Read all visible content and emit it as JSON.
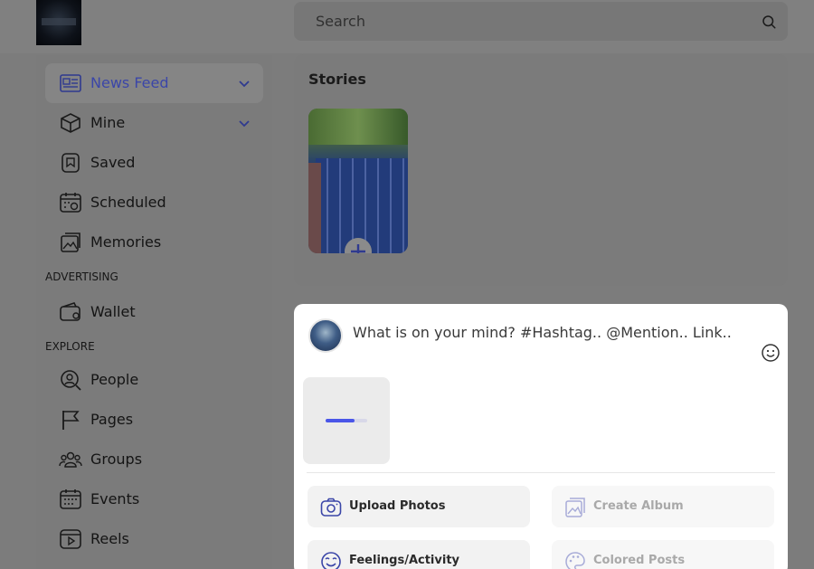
{
  "header": {
    "search_placeholder": "Search",
    "search_icon": "search-icon"
  },
  "sidebar": {
    "items": [
      {
        "label": "News Feed",
        "icon": "newspaper-icon",
        "active": true,
        "has_chevron": true
      },
      {
        "label": "Mine",
        "icon": "box-icon",
        "has_chevron": true
      },
      {
        "label": "Saved",
        "icon": "bookmark-icon"
      },
      {
        "label": "Scheduled",
        "icon": "calendar-clock-icon"
      },
      {
        "label": "Memories",
        "icon": "photos-icon"
      }
    ],
    "advertising_label": "ADVERTISING",
    "advertising_items": [
      {
        "label": "Wallet",
        "icon": "wallet-icon"
      }
    ],
    "explore_label": "EXPLORE",
    "explore_items": [
      {
        "label": "People",
        "icon": "people-search-icon"
      },
      {
        "label": "Pages",
        "icon": "flag-icon"
      },
      {
        "label": "Groups",
        "icon": "groups-icon"
      },
      {
        "label": "Events",
        "icon": "calendar-icon"
      },
      {
        "label": "Reels",
        "icon": "play-icon"
      }
    ]
  },
  "stories": {
    "title": "Stories",
    "add_icon": "plus-icon"
  },
  "composer": {
    "placeholder": "What is on your mind? #Hashtag.. @Mention.. Link..",
    "emoji_icon": "smiley-icon",
    "upload_progress": 0.7,
    "actions": [
      {
        "label": "Upload Photos",
        "icon": "camera-icon",
        "enabled": true
      },
      {
        "label": "Create Album",
        "icon": "album-icon",
        "enabled": false
      },
      {
        "label": "Feelings/Activity",
        "icon": "feelings-icon",
        "enabled": true
      },
      {
        "label": "Colored Posts",
        "icon": "palette-icon",
        "enabled": false
      }
    ]
  },
  "colors": {
    "accent": "#4a56e8",
    "active_nav_text": "#3b46a8",
    "overlay_bg": "#7c7c7c"
  }
}
